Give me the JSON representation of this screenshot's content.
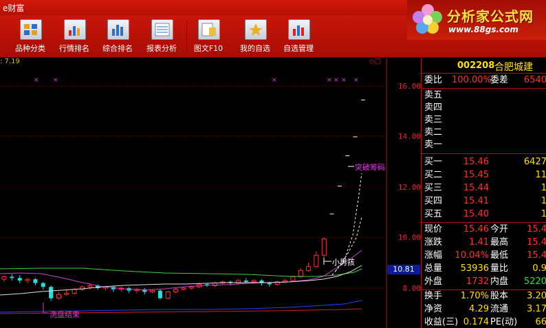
{
  "window": {
    "title": "e财富"
  },
  "toolbar": {
    "buttons": [
      {
        "label": "品种分类",
        "icon": "category-icon"
      },
      {
        "label": "行情排名",
        "icon": "ranking-icon"
      },
      {
        "label": "综合排名",
        "icon": "overall-ranking-icon"
      },
      {
        "label": "报表分析",
        "icon": "report-icon"
      },
      {
        "label": "图文F10",
        "icon": "f10-icon"
      },
      {
        "label": "我的自选",
        "icon": "favorites-icon"
      },
      {
        "label": "自选管理",
        "icon": "favorites-manage-icon"
      }
    ]
  },
  "logo": {
    "text": "分析家公式网",
    "url": "www.88gs.com"
  },
  "chart": {
    "ref_label": ": 7.19",
    "corner_marks": "◇□",
    "current_price_tag": "10.81",
    "y_labels": [
      "16.00",
      "14.00",
      "12.00",
      "10.00",
      "8.00"
    ],
    "annotations": {
      "breakout": "突破筹码",
      "boy": "小男孩",
      "wash": "洗盘结束"
    }
  },
  "chart_data": {
    "type": "candlestick",
    "y_ticks": [
      16.0,
      14.0,
      12.0,
      10.0,
      8.0
    ],
    "current_price": 10.81,
    "annotations": [
      "突破筹码",
      "小男孩",
      "洗盘结束"
    ]
  },
  "quote": {
    "code": "002208",
    "name": "合肥城建",
    "ratio": {
      "label": "委比",
      "value": "100.00%",
      "label2": "委差",
      "value2": "6540"
    },
    "sells": [
      {
        "label": "卖五",
        "price": "",
        "vol": ""
      },
      {
        "label": "卖四",
        "price": "",
        "vol": ""
      },
      {
        "label": "卖三",
        "price": "",
        "vol": ""
      },
      {
        "label": "卖二",
        "price": "",
        "vol": ""
      },
      {
        "label": "卖一",
        "price": "",
        "vol": ""
      }
    ],
    "buys": [
      {
        "label": "买一",
        "price": "15.46",
        "vol": "6427"
      },
      {
        "label": "买二",
        "price": "15.45",
        "vol": "11"
      },
      {
        "label": "买三",
        "price": "15.44",
        "vol": "1"
      },
      {
        "label": "买四",
        "price": "15.41",
        "vol": "1"
      },
      {
        "label": "买五",
        "price": "15.40",
        "vol": "1"
      }
    ],
    "stats": [
      {
        "l1": "现价",
        "v1": "15.46",
        "l2": "今开",
        "v2": "15.4"
      },
      {
        "l1": "涨跌",
        "v1": "1.41",
        "l2": "最高",
        "v2": "15.4"
      },
      {
        "l1": "涨幅",
        "v1": "10.04%",
        "l2": "最低",
        "v2": "15.4"
      },
      {
        "l1": "总量",
        "v1": "53936",
        "l2": "量比",
        "v2": "0.9"
      },
      {
        "l1": "外盘",
        "v1": "1732",
        "l2": "内盘",
        "v2": "5220"
      }
    ],
    "stats2": [
      {
        "l1": "换手",
        "v1": "1.70%",
        "l2": "股本",
        "v2": "3.20"
      },
      {
        "l1": "净资",
        "v1": "4.29",
        "l2": "流通",
        "v2": "3.17"
      },
      {
        "l1": "收益(三)",
        "v1": "0.174",
        "l2": "PE(动)",
        "v2": "66"
      }
    ]
  }
}
